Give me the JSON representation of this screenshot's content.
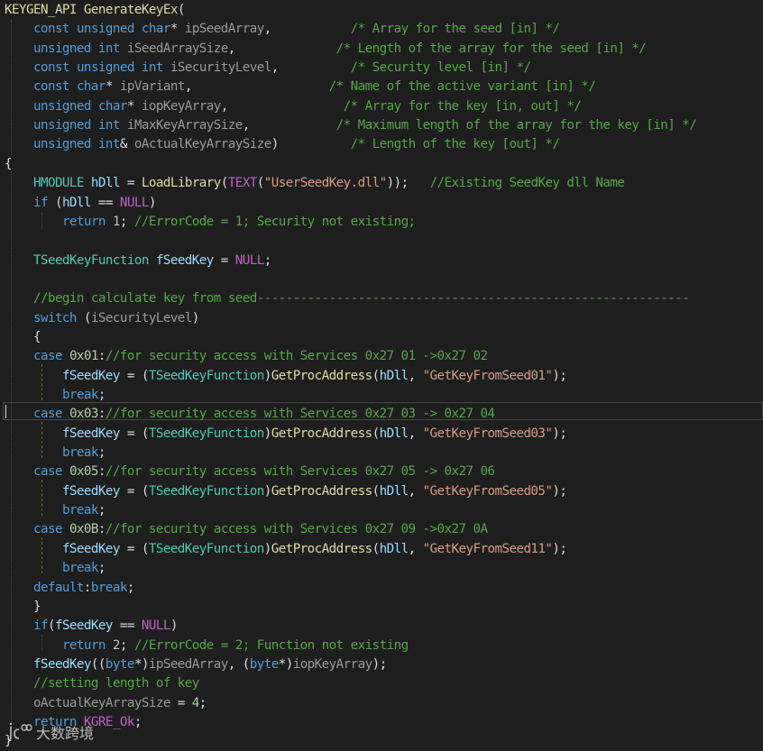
{
  "editor": {
    "lines": [
      [
        [
          "fn",
          "KEYGEN_API"
        ],
        [
          "tx",
          " "
        ],
        [
          "fn",
          "GenerateKeyEx"
        ],
        [
          "tx",
          "("
        ]
      ],
      [
        [
          "tx",
          "    "
        ],
        [
          "kw",
          "const"
        ],
        [
          "tx",
          " "
        ],
        [
          "kw",
          "unsigned"
        ],
        [
          "tx",
          " "
        ],
        [
          "kw",
          "char"
        ],
        [
          "tx",
          "* "
        ],
        [
          "pa",
          "ipSeedArray"
        ],
        [
          "tx",
          ",           "
        ],
        [
          "cm",
          "/* Array for the seed [in] */"
        ]
      ],
      [
        [
          "tx",
          "    "
        ],
        [
          "kw",
          "unsigned"
        ],
        [
          "tx",
          " "
        ],
        [
          "kw",
          "int"
        ],
        [
          "tx",
          " "
        ],
        [
          "pa",
          "iSeedArraySize"
        ],
        [
          "tx",
          ",              "
        ],
        [
          "cm",
          "/* Length of the array for the seed [in] */"
        ]
      ],
      [
        [
          "tx",
          "    "
        ],
        [
          "kw",
          "const"
        ],
        [
          "tx",
          " "
        ],
        [
          "kw",
          "unsigned"
        ],
        [
          "tx",
          " "
        ],
        [
          "kw",
          "int"
        ],
        [
          "tx",
          " "
        ],
        [
          "pa",
          "iSecurityLevel"
        ],
        [
          "tx",
          ",          "
        ],
        [
          "cm",
          "/* Security level [in] */"
        ]
      ],
      [
        [
          "tx",
          "    "
        ],
        [
          "kw",
          "const"
        ],
        [
          "tx",
          " "
        ],
        [
          "kw",
          "char"
        ],
        [
          "tx",
          "* "
        ],
        [
          "pa",
          "ipVariant"
        ],
        [
          "tx",
          ",                   "
        ],
        [
          "cm",
          "/* Name of the active variant [in] */"
        ]
      ],
      [
        [
          "tx",
          "    "
        ],
        [
          "kw",
          "unsigned"
        ],
        [
          "tx",
          " "
        ],
        [
          "kw",
          "char"
        ],
        [
          "tx",
          "* "
        ],
        [
          "pa",
          "iopKeyArray"
        ],
        [
          "tx",
          ",                "
        ],
        [
          "cm",
          "/* Array for the key [in, out] */"
        ]
      ],
      [
        [
          "tx",
          "    "
        ],
        [
          "kw",
          "unsigned"
        ],
        [
          "tx",
          " "
        ],
        [
          "kw",
          "int"
        ],
        [
          "tx",
          " "
        ],
        [
          "pa",
          "iMaxKeyArraySize"
        ],
        [
          "tx",
          ",            "
        ],
        [
          "cm",
          "/* Maximum length of the array for the key [in] */"
        ]
      ],
      [
        [
          "tx",
          "    "
        ],
        [
          "kw",
          "unsigned"
        ],
        [
          "tx",
          " "
        ],
        [
          "kw",
          "int"
        ],
        [
          "tx",
          "& "
        ],
        [
          "pa",
          "oActualKeyArraySize"
        ],
        [
          "tx",
          ")          "
        ],
        [
          "cm",
          "/* Length of the key [out] */"
        ]
      ],
      [
        [
          "tx",
          "{"
        ]
      ],
      [
        [
          "tx",
          "    "
        ],
        [
          "ty",
          "HMODULE"
        ],
        [
          "tx",
          " "
        ],
        [
          "lv",
          "hDll"
        ],
        [
          "tx",
          " = "
        ],
        [
          "fn",
          "LoadLibrary"
        ],
        [
          "tx",
          "("
        ],
        [
          "mc",
          "TEXT"
        ],
        [
          "tx",
          "("
        ],
        [
          "st",
          "\"UserSeedKey.dll\""
        ],
        [
          "tx",
          "));   "
        ],
        [
          "cm",
          "//Existing SeedKey dll Name"
        ]
      ],
      [
        [
          "tx",
          "    "
        ],
        [
          "kw",
          "if"
        ],
        [
          "tx",
          " ("
        ],
        [
          "lv",
          "hDll"
        ],
        [
          "tx",
          " == "
        ],
        [
          "mc",
          "NULL"
        ],
        [
          "tx",
          ")"
        ]
      ],
      [
        [
          "tx",
          "        "
        ],
        [
          "kw",
          "return"
        ],
        [
          "tx",
          " "
        ],
        [
          "nu",
          "1"
        ],
        [
          "tx",
          "; "
        ],
        [
          "cm",
          "//ErrorCode = 1; Security not existing;"
        ]
      ],
      [
        [
          "tx",
          ""
        ]
      ],
      [
        [
          "tx",
          "    "
        ],
        [
          "ty",
          "TSeedKeyFunction"
        ],
        [
          "tx",
          " "
        ],
        [
          "lv",
          "fSeedKey"
        ],
        [
          "tx",
          " = "
        ],
        [
          "mc",
          "NULL"
        ],
        [
          "tx",
          ";"
        ]
      ],
      [
        [
          "tx",
          ""
        ]
      ],
      [
        [
          "tx",
          "    "
        ],
        [
          "cm",
          "//begin calculate key from seed------------------------------------------------------------"
        ]
      ],
      [
        [
          "tx",
          "    "
        ],
        [
          "kw",
          "switch"
        ],
        [
          "tx",
          " ("
        ],
        [
          "pa",
          "iSecurityLevel"
        ],
        [
          "tx",
          ")"
        ]
      ],
      [
        [
          "tx",
          "    {"
        ]
      ],
      [
        [
          "tx",
          "    "
        ],
        [
          "kw",
          "case"
        ],
        [
          "tx",
          " "
        ],
        [
          "nu",
          "0x01"
        ],
        [
          "tx",
          ":"
        ],
        [
          "cm",
          "//for security access with Services 0x27 01 ->0x27 02"
        ]
      ],
      [
        [
          "tx",
          "        "
        ],
        [
          "lv",
          "fSeedKey"
        ],
        [
          "tx",
          " = ("
        ],
        [
          "ty",
          "TSeedKeyFunction"
        ],
        [
          "tx",
          ")"
        ],
        [
          "fn",
          "GetProcAddress"
        ],
        [
          "tx",
          "("
        ],
        [
          "lv",
          "hDll"
        ],
        [
          "tx",
          ", "
        ],
        [
          "st",
          "\"GetKeyFromSeed01\""
        ],
        [
          "tx",
          ");"
        ]
      ],
      [
        [
          "tx",
          "        "
        ],
        [
          "kw",
          "break"
        ],
        [
          "tx",
          ";"
        ]
      ],
      [
        [
          "tx",
          "    "
        ],
        [
          "kw",
          "case"
        ],
        [
          "tx",
          " "
        ],
        [
          "nu",
          "0x03"
        ],
        [
          "tx",
          ":"
        ],
        [
          "cm",
          "//for security access with Services 0x27 03 -> 0x27 04"
        ]
      ],
      [
        [
          "tx",
          "        "
        ],
        [
          "lv",
          "fSeedKey"
        ],
        [
          "tx",
          " = ("
        ],
        [
          "ty",
          "TSeedKeyFunction"
        ],
        [
          "tx",
          ")"
        ],
        [
          "fn",
          "GetProcAddress"
        ],
        [
          "tx",
          "("
        ],
        [
          "lv",
          "hDll"
        ],
        [
          "tx",
          ", "
        ],
        [
          "st",
          "\"GetKeyFromSeed03\""
        ],
        [
          "tx",
          ");"
        ]
      ],
      [
        [
          "tx",
          "        "
        ],
        [
          "kw",
          "break"
        ],
        [
          "tx",
          ";"
        ]
      ],
      [
        [
          "tx",
          "    "
        ],
        [
          "kw",
          "case"
        ],
        [
          "tx",
          " "
        ],
        [
          "nu",
          "0x05"
        ],
        [
          "tx",
          ":"
        ],
        [
          "cm",
          "//for security access with Services 0x27 05 -> 0x27 06"
        ]
      ],
      [
        [
          "tx",
          "        "
        ],
        [
          "lv",
          "fSeedKey"
        ],
        [
          "tx",
          " = ("
        ],
        [
          "ty",
          "TSeedKeyFunction"
        ],
        [
          "tx",
          ")"
        ],
        [
          "fn",
          "GetProcAddress"
        ],
        [
          "tx",
          "("
        ],
        [
          "lv",
          "hDll"
        ],
        [
          "tx",
          ", "
        ],
        [
          "st",
          "\"GetKeyFromSeed05\""
        ],
        [
          "tx",
          ");"
        ]
      ],
      [
        [
          "tx",
          "        "
        ],
        [
          "kw",
          "break"
        ],
        [
          "tx",
          ";"
        ]
      ],
      [
        [
          "tx",
          "    "
        ],
        [
          "kw",
          "case"
        ],
        [
          "tx",
          " "
        ],
        [
          "nu",
          "0x0B"
        ],
        [
          "tx",
          ":"
        ],
        [
          "cm",
          "//for security access with Services 0x27 09 ->0x27 0A"
        ]
      ],
      [
        [
          "tx",
          "        "
        ],
        [
          "lv",
          "fSeedKey"
        ],
        [
          "tx",
          " = ("
        ],
        [
          "ty",
          "TSeedKeyFunction"
        ],
        [
          "tx",
          ")"
        ],
        [
          "fn",
          "GetProcAddress"
        ],
        [
          "tx",
          "("
        ],
        [
          "lv",
          "hDll"
        ],
        [
          "tx",
          ", "
        ],
        [
          "st",
          "\"GetKeyFromSeed11\""
        ],
        [
          "tx",
          ");"
        ]
      ],
      [
        [
          "tx",
          "        "
        ],
        [
          "kw",
          "break"
        ],
        [
          "tx",
          ";"
        ]
      ],
      [
        [
          "tx",
          "    "
        ],
        [
          "kw",
          "default"
        ],
        [
          "tx",
          ":"
        ],
        [
          "kw",
          "break"
        ],
        [
          "tx",
          ";"
        ]
      ],
      [
        [
          "tx",
          "    }"
        ]
      ],
      [
        [
          "tx",
          "    "
        ],
        [
          "kw",
          "if"
        ],
        [
          "tx",
          "("
        ],
        [
          "lv",
          "fSeedKey"
        ],
        [
          "tx",
          " == "
        ],
        [
          "mc",
          "NULL"
        ],
        [
          "tx",
          ")"
        ]
      ],
      [
        [
          "tx",
          "        "
        ],
        [
          "kw",
          "return"
        ],
        [
          "tx",
          " "
        ],
        [
          "nu",
          "2"
        ],
        [
          "tx",
          "; "
        ],
        [
          "cm",
          "//ErrorCode = 2; Function not existing"
        ]
      ],
      [
        [
          "tx",
          "    "
        ],
        [
          "lv",
          "fSeedKey"
        ],
        [
          "tx",
          "(("
        ],
        [
          "kw",
          "byte"
        ],
        [
          "tx",
          "*)"
        ],
        [
          "pa",
          "ipSeedArray"
        ],
        [
          "tx",
          ", ("
        ],
        [
          "kw",
          "byte"
        ],
        [
          "tx",
          "*)"
        ],
        [
          "pa",
          "iopKeyArray"
        ],
        [
          "tx",
          ");"
        ]
      ],
      [
        [
          "tx",
          "    "
        ],
        [
          "cm",
          "//setting length of key"
        ]
      ],
      [
        [
          "tx",
          "    "
        ],
        [
          "pa",
          "oActualKeyArraySize"
        ],
        [
          "tx",
          " = "
        ],
        [
          "nu",
          "4"
        ],
        [
          "tx",
          ";"
        ]
      ],
      [
        [
          "tx",
          "    "
        ],
        [
          "kw",
          "return"
        ],
        [
          "tx",
          " "
        ],
        [
          "mc",
          "KGRE_Ok"
        ],
        [
          "tx",
          ";"
        ]
      ],
      [
        [
          "tx",
          "}"
        ]
      ]
    ]
  },
  "watermark": {
    "text": "大数跨境"
  }
}
